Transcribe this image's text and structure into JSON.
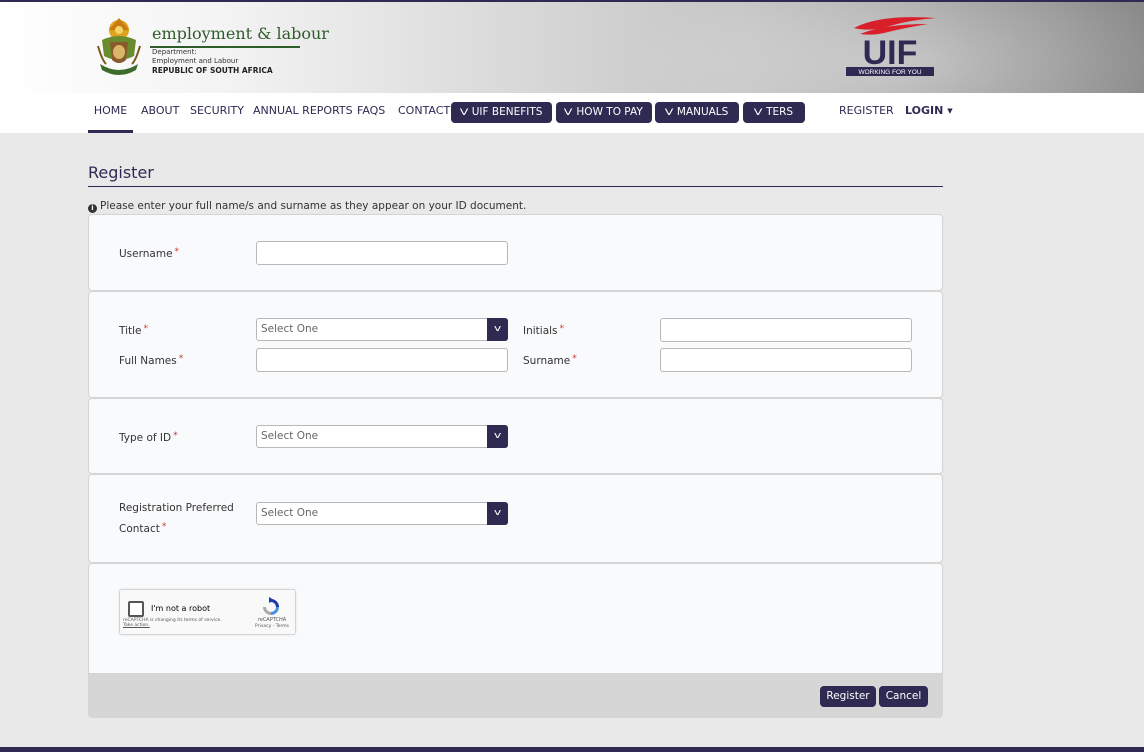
{
  "header": {
    "dept_title": "employment & labour",
    "dept_sub_1": "Department:",
    "dept_sub_2": "Employment and Labour",
    "dept_country": "REPUBLIC OF SOUTH AFRICA",
    "uif_logo_text": "UIF",
    "uif_tagline": "WORKING FOR YOU"
  },
  "nav": {
    "links": [
      {
        "label": "HOME",
        "active": true
      },
      {
        "label": "ABOUT"
      },
      {
        "label": "SECURITY"
      },
      {
        "label": "ANNUAL REPORTS"
      },
      {
        "label": "FAQS"
      },
      {
        "label": "CONTACT"
      }
    ],
    "pills": [
      {
        "label": "UIF BENEFITS"
      },
      {
        "label": "HOW TO PAY"
      },
      {
        "label": "MANUALS"
      },
      {
        "label": "TERS"
      }
    ],
    "register": "REGISTER",
    "login": "LOGIN"
  },
  "page": {
    "title": "Register",
    "info": "Please enter your full name/s and surname as they appear on your ID document."
  },
  "form": {
    "required_mark": "*",
    "username_label": "Username",
    "title_label": "Title",
    "title_value": "Select One",
    "initials_label": "Initials",
    "full_names_label": "Full Names",
    "surname_label": "Surname",
    "id_type_label": "Type of ID",
    "id_type_value": "Select One",
    "contact_label_1": "Registration Preferred",
    "contact_label_2": "Contact",
    "contact_value": "Select One"
  },
  "captcha": {
    "label": "I'm not a robot",
    "note_1": "reCAPTCHA is changing its terms of service.",
    "note_2": "Take action.",
    "brand": "reCAPTCHA",
    "links": "Privacy - Terms"
  },
  "buttons": {
    "register": "Register",
    "cancel": "Cancel"
  },
  "colors": {
    "brand": "#2e2a52",
    "required": "#c0392b"
  }
}
